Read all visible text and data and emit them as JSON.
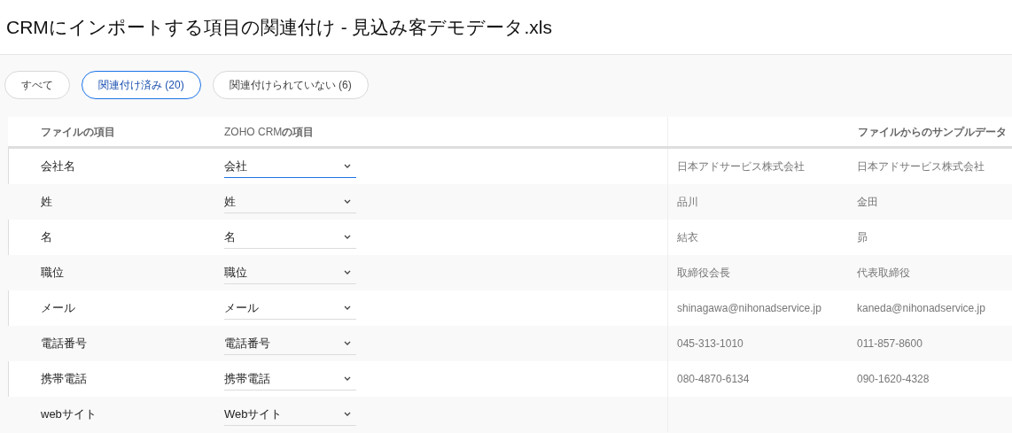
{
  "title": "CRMにインポートする項目の関連付け - 見込み客デモデータ.xls",
  "filters": [
    {
      "label": "すべて",
      "selected": false
    },
    {
      "label": "関連付け済み (20)",
      "selected": true
    },
    {
      "label": "関連付けられていない (6)",
      "selected": false
    }
  ],
  "table": {
    "columns": [
      "ファイルの項目",
      "ZOHO CRM**の項目**",
      "ファイルからのサンプルデータ"
    ],
    "rows": [
      {
        "field": "会社名",
        "mapped": "会社",
        "focused": true,
        "samples": [
          "日本アドサービス株式会社",
          "日本アドサービス株式会社"
        ]
      },
      {
        "field": "姓",
        "mapped": "姓",
        "focused": false,
        "samples": [
          "品川",
          "金田"
        ]
      },
      {
        "field": "名",
        "mapped": "名",
        "focused": false,
        "samples": [
          "結衣",
          "昴"
        ]
      },
      {
        "field": "職位",
        "mapped": "職位",
        "focused": false,
        "samples": [
          "取締役会長",
          "代表取締役"
        ]
      },
      {
        "field": "メール",
        "mapped": "メール",
        "focused": false,
        "samples": [
          "shinagawa@nihonadservice.jp",
          "kaneda@nihonadservice.jp"
        ]
      },
      {
        "field": "電話番号",
        "mapped": "電話番号",
        "focused": false,
        "samples": [
          "045-313-1010",
          "011-857-8600"
        ]
      },
      {
        "field": "携帯電話",
        "mapped": "携帯電話",
        "focused": false,
        "samples": [
          "080-4870-6134",
          "090-1620-4328"
        ]
      },
      {
        "field": "webサイト",
        "mapped": "Webサイト",
        "focused": false,
        "samples": []
      }
    ]
  }
}
